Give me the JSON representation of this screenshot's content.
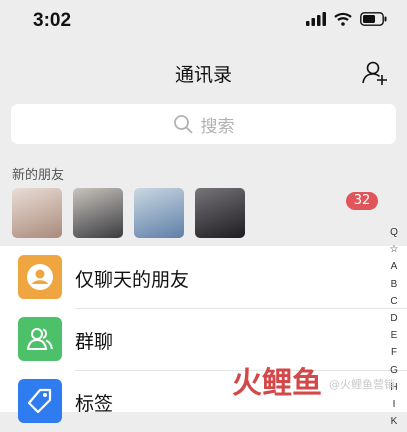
{
  "status_bar": {
    "time": "3:02"
  },
  "nav": {
    "title": "通讯录"
  },
  "search": {
    "placeholder": "搜索"
  },
  "new_friends": {
    "label": "新的朋友",
    "badge": "32",
    "avatar_colors": [
      [
        "#a98a7a",
        "#e9ddd6"
      ],
      [
        "#3a3b40",
        "#c9c4be"
      ],
      [
        "#5d7fa7",
        "#cbd7e2"
      ],
      [
        "#1d1c20",
        "#787479"
      ]
    ]
  },
  "list": {
    "items": [
      {
        "label": "仅聊天的朋友",
        "icon": "person-bubble-icon",
        "color": "#f0a640"
      },
      {
        "label": "群聊",
        "icon": "group-icon",
        "color": "#4dc06a"
      },
      {
        "label": "标签",
        "icon": "tag-icon",
        "color": "#2f7bf0"
      }
    ]
  },
  "index_bar": {
    "letters": [
      "Q",
      "☆",
      "A",
      "B",
      "C",
      "D",
      "E",
      "F",
      "G",
      "H",
      "I",
      "K"
    ]
  },
  "watermark": {
    "text": "火鲤鱼",
    "sub": "@火鲤鱼营销"
  }
}
